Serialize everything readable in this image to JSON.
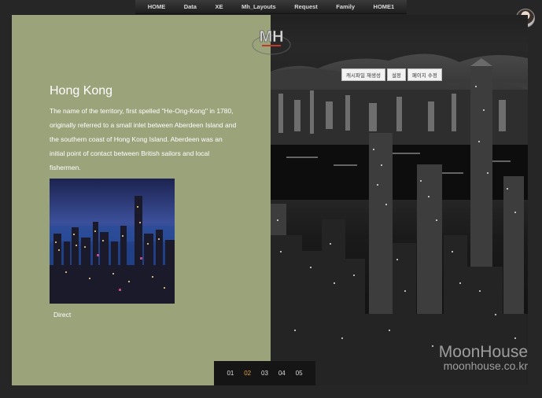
{
  "nav": {
    "items": [
      "HOME",
      "Data",
      "XE",
      "Mh_Layouts",
      "Request",
      "Family",
      "HOME1"
    ]
  },
  "logo": {
    "text": "MH"
  },
  "content": {
    "title": "Hong Kong",
    "description": "The name of the territory, first spelled \"He-Ong-Kong\" in 1780, originally referred to a small inlet between Aberdeen Island and the southern coast of Hong Kong Island. Aberdeen was an initial point of contact between British sailors and local fishermen.",
    "link": "Direct"
  },
  "admin_buttons": [
    "캐시파일 재생성",
    "설정",
    "페이지 수정"
  ],
  "pager": {
    "pages": [
      "01",
      "02",
      "03",
      "04",
      "05"
    ],
    "active_index": 1
  },
  "watermark": {
    "line1": "MoonHouse",
    "line2": "moonhouse.co.kr"
  },
  "colors": {
    "panel": "#9ba37b",
    "active_page": "#e8a040"
  }
}
